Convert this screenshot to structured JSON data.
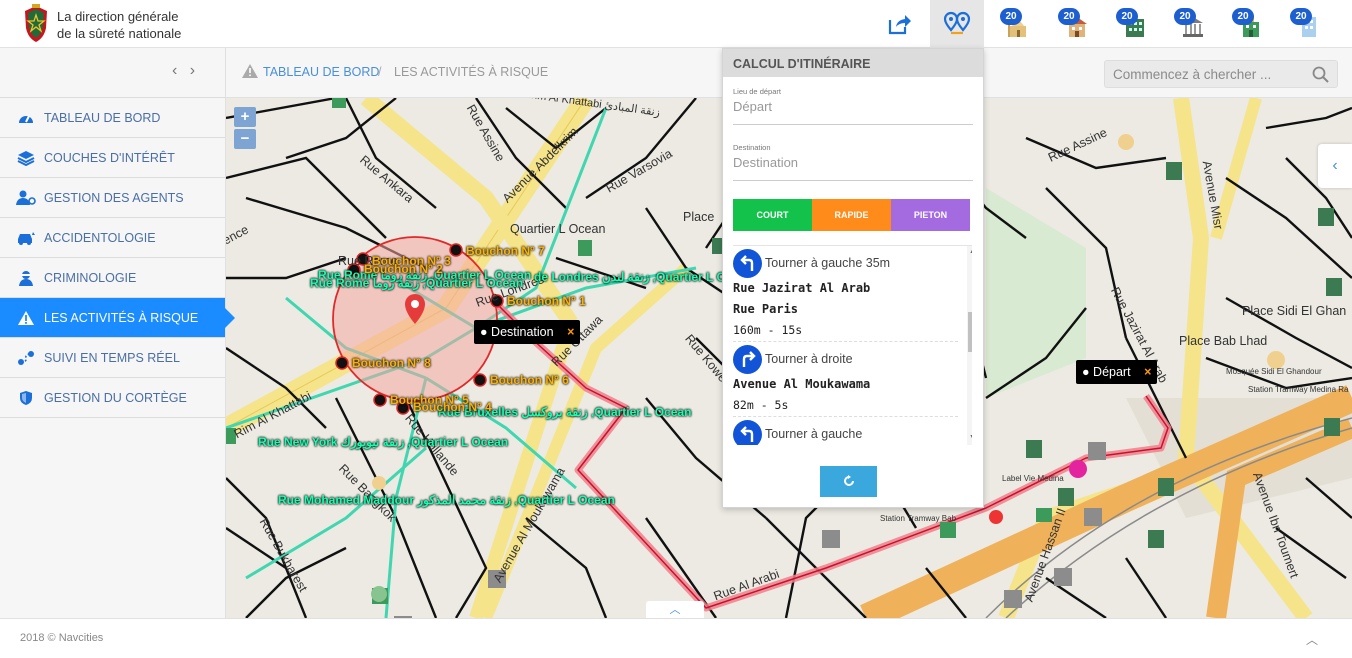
{
  "header": {
    "brand_line1": "La direction générale",
    "brand_line2": "de la sûreté nationale",
    "layer_badges": [
      "20",
      "20",
      "20",
      "20",
      "20",
      "20"
    ]
  },
  "sidebar": {
    "collapse_icon": "‹ ›",
    "items": [
      {
        "label": "TABLEAU DE BORD",
        "icon": "dashboard-icon"
      },
      {
        "label": "COUCHES D'INTÉRÊT",
        "icon": "layers-icon"
      },
      {
        "label": "GESTION DES AGENTS",
        "icon": "agents-icon"
      },
      {
        "label": "ACCIDENTOLOGIE",
        "icon": "car-crash-icon"
      },
      {
        "label": "CRIMINOLOGIE",
        "icon": "criminal-icon"
      },
      {
        "label": "LES ACTIVITÉS À RISQUE",
        "icon": "warning-icon",
        "active": true
      },
      {
        "label": "SUIVI EN TEMPS RÉEL",
        "icon": "route-tracking-icon"
      },
      {
        "label": "GESTION DU CORTÈGE",
        "icon": "shield-icon"
      }
    ]
  },
  "breadcrumb": {
    "item1": "TABLEAU DE BORD",
    "separator": "/",
    "item2": "LES ACTIVITÉS À RISQUE"
  },
  "search": {
    "placeholder": "Commencez à chercher ..."
  },
  "map": {
    "zoom_in": "+",
    "zoom_out": "−",
    "street_labels": [
      "Avenue Abdelkrim Al Khattabi زنقة المبادئ",
      "Rue Assine",
      "Rue Ankara",
      "Avenue Abdelkrim",
      "Rue Varsovia",
      "Quartier L Ocean",
      "Place",
      "Rue Assine",
      "Avenue Misr",
      "Rue Jazirat Al Arab",
      "Place Sidi El Ghan",
      "Place Bab Lhad",
      "Mosquée Sidi El Ghandour",
      "Station Tramway Medina Ra",
      "Label Vie Medina",
      "Station Tramway Bab",
      "Rue Koweït",
      "Rue Ottawa",
      "Avenue Al Moukawama",
      "Avenue Hassan II",
      "Avenue Ibn Toumert",
      "Rue Bukharest",
      "Rue Bangkok",
      "Rue Hollande",
      "Rue Al Arabi",
      "Rue Rome",
      "Rue Londres",
      "Rim Al Khattabi",
      "ence"
    ],
    "bouchons": [
      "Bouchon N° 7",
      "Bouchon N° 3",
      "Bouchon N° 2",
      "Bouchon N° 1",
      "Bouchon N° 8",
      "Bouchon N° 6",
      "Bouchon N° 5",
      "Bouchon N° 4"
    ],
    "green_labels": [
      "Rue Rome زنقة روما ,Quartier L Ocean",
      "Rue Rome زنقة روما ,Quartier L Ocean",
      "de Londres زنقة لندن ,Quartier L Ocean",
      "Rue Bruxelles زنقة بروكسل ,Quartier L Ocean",
      "Rue New York زنقة نيويورك ,Quartier L Ocean",
      "Rue Mohamed Maddour زنقة محمد المذكور ,Quartier L Ocean"
    ],
    "destination_tag": "Destination",
    "depart_tag": "Départ",
    "close_mark": "×",
    "right_toggle": "‹",
    "bottom_toggle": "︿"
  },
  "itinerary": {
    "title": "CALCUL D'ITINÉRAIRE",
    "start_label": "Lieu de départ",
    "start_value": "Départ",
    "dest_label": "Destination",
    "dest_value": "Destination",
    "modes": [
      {
        "label": "COURT",
        "color": "#12c24b"
      },
      {
        "label": "RAPIDE",
        "color": "#ff8c1a"
      },
      {
        "label": "PIETON",
        "color": "#a46be0"
      }
    ],
    "steps": [
      {
        "instruction": "Tourner à gauche 35m",
        "direction": "left",
        "streets": [],
        "distance": ""
      },
      {
        "instruction": "",
        "direction": "",
        "streets": [
          "Rue Jazirat Al Arab",
          "Rue Paris"
        ],
        "distance": "160m - 15s"
      },
      {
        "instruction": "Tourner à droite",
        "direction": "right",
        "streets": [
          "Avenue Al Moukawama"
        ],
        "distance": "82m - 5s"
      },
      {
        "instruction": "Tourner à gauche",
        "direction": "left",
        "streets": [],
        "distance": ""
      }
    ],
    "refresh_icon": "refresh-icon"
  },
  "footer": {
    "copyright": "2018 © Navcities",
    "up_icon": "︿"
  },
  "colors": {
    "accent": "#1a8cff",
    "badge": "#1e5fd0",
    "route": "#f07f8a",
    "tram": "#3fd6b0"
  }
}
